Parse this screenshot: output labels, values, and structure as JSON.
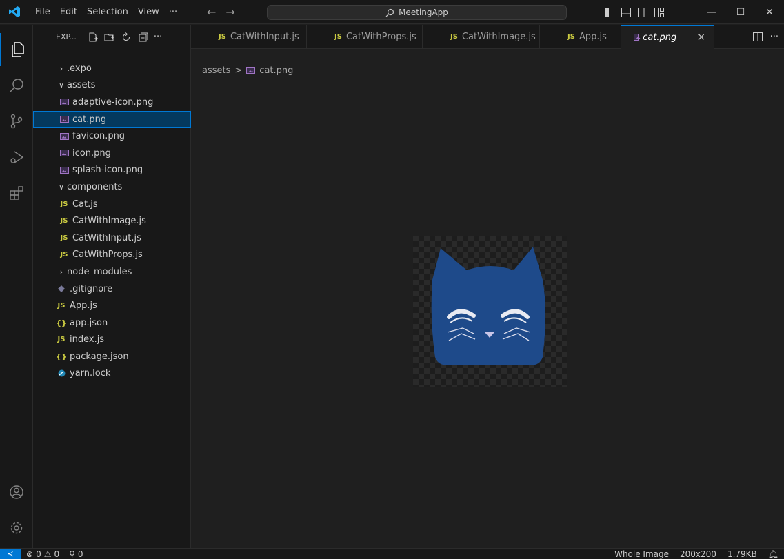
{
  "titlebar": {
    "menu": [
      "File",
      "Edit",
      "Selection",
      "View",
      "···"
    ],
    "search_text": "MeetingApp"
  },
  "sidebar": {
    "title": "EXP...",
    "more": "···",
    "tree": [
      {
        "label": ".expo",
        "type": "folder",
        "state": "collapsed",
        "depth": 0
      },
      {
        "label": "assets",
        "type": "folder",
        "state": "expanded",
        "depth": 0
      },
      {
        "label": "adaptive-icon.png",
        "type": "image",
        "depth": 1
      },
      {
        "label": "cat.png",
        "type": "image",
        "depth": 1,
        "selected": true
      },
      {
        "label": "favicon.png",
        "type": "image",
        "depth": 1
      },
      {
        "label": "icon.png",
        "type": "image",
        "depth": 1
      },
      {
        "label": "splash-icon.png",
        "type": "image",
        "depth": 1
      },
      {
        "label": "components",
        "type": "folder",
        "state": "expanded",
        "depth": 0
      },
      {
        "label": "Cat.js",
        "type": "js",
        "depth": 1
      },
      {
        "label": "CatWithImage.js",
        "type": "js",
        "depth": 1
      },
      {
        "label": "CatWithInput.js",
        "type": "js",
        "depth": 1
      },
      {
        "label": "CatWithProps.js",
        "type": "js",
        "depth": 1
      },
      {
        "label": "node_modules",
        "type": "folder",
        "state": "collapsed",
        "depth": 0
      },
      {
        "label": ".gitignore",
        "type": "git",
        "depth": 0
      },
      {
        "label": "App.js",
        "type": "js",
        "depth": 0
      },
      {
        "label": "app.json",
        "type": "json",
        "depth": 0
      },
      {
        "label": "index.js",
        "type": "js",
        "depth": 0
      },
      {
        "label": "package.json",
        "type": "json",
        "depth": 0
      },
      {
        "label": "yarn.lock",
        "type": "yarn",
        "depth": 0
      }
    ]
  },
  "tabs": [
    {
      "label": "CatWithInput.js",
      "type": "js"
    },
    {
      "label": "CatWithProps.js",
      "type": "js"
    },
    {
      "label": "CatWithImage.js",
      "type": "js"
    },
    {
      "label": "App.js",
      "type": "js"
    },
    {
      "label": "cat.png",
      "type": "image",
      "active": true
    }
  ],
  "tab_close": "×",
  "tab_more": "···",
  "icon_text": {
    "js": "JS",
    "json": "{}"
  },
  "breadcrumb": {
    "folder": "assets",
    "separator": ">",
    "file": "cat.png"
  },
  "statusbar": {
    "remote": "≺",
    "errors": "0",
    "warnings": "0",
    "ports": "0",
    "zoom": "Whole Image",
    "dimensions": "200x200",
    "size": "1.79KB"
  },
  "colors": {
    "accent": "#0078d4",
    "cat": "#1e4a8a",
    "js": "#cbcb41",
    "image": "#a074c4"
  }
}
